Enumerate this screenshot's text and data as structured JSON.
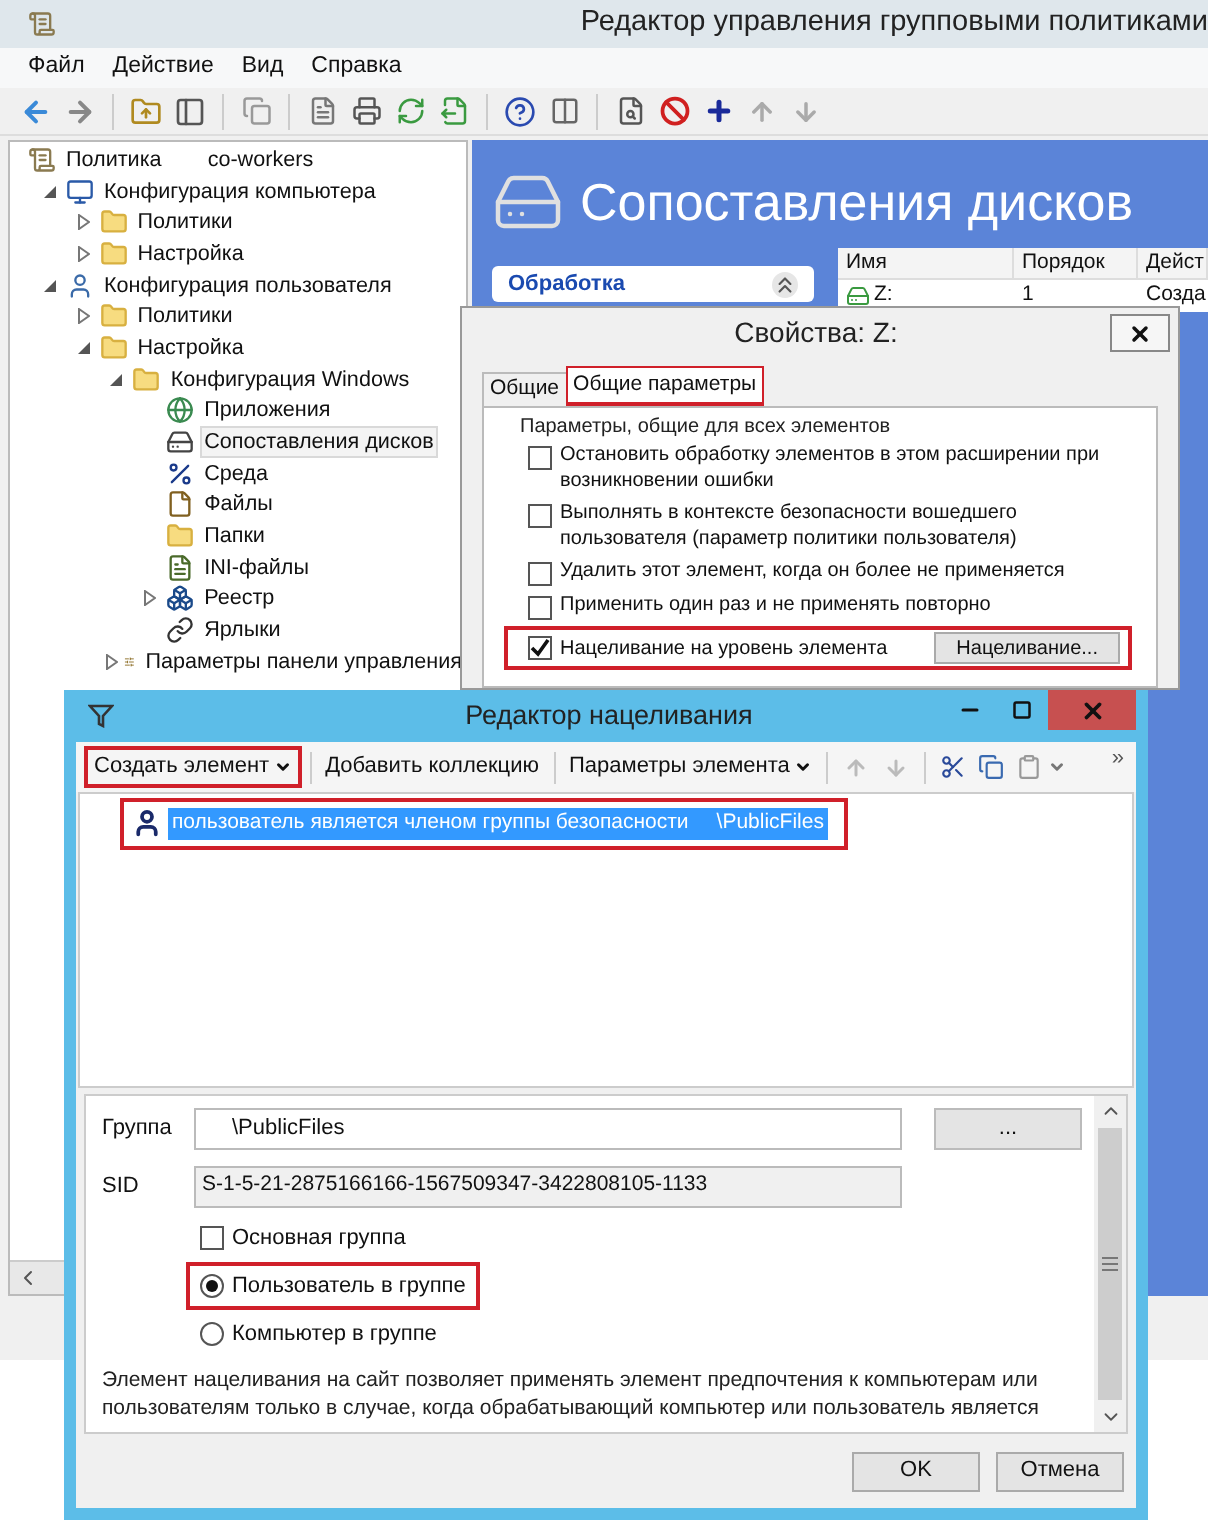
{
  "main_window": {
    "title": "Редактор управления групповыми политиками",
    "menu": [
      "Файл",
      "Действие",
      "Вид",
      "Справка"
    ],
    "tree": [
      {
        "kind": "policy",
        "label": "Политика",
        "suffix": "co-workers",
        "selected": false,
        "children": [
          {
            "kind": "computer",
            "label": "Конфигурация компьютера",
            "expanded": true,
            "selected": false,
            "children": [
              {
                "kind": "folder",
                "label": "Политики",
                "expanded": false,
                "selected": false
              },
              {
                "kind": "folder",
                "label": "Настройка",
                "expanded": false,
                "selected": false
              }
            ]
          },
          {
            "kind": "user",
            "label": "Конфигурация пользователя",
            "expanded": true,
            "selected": false,
            "children": [
              {
                "kind": "folder",
                "label": "Политики",
                "expanded": false,
                "selected": false
              },
              {
                "kind": "folder",
                "label": "Настройка",
                "expanded": true,
                "selected": false,
                "children": [
                  {
                    "kind": "folder",
                    "label": "Конфигурация Windows",
                    "expanded": true,
                    "selected": false,
                    "children": [
                      {
                        "kind": "apps",
                        "label": "Приложения",
                        "selected": false
                      },
                      {
                        "kind": "drive",
                        "label": "Сопоставления дисков",
                        "selected": true
                      },
                      {
                        "kind": "environment",
                        "label": "Среда",
                        "selected": false
                      },
                      {
                        "kind": "files",
                        "label": "Файлы",
                        "selected": false
                      },
                      {
                        "kind": "folders",
                        "label": "Папки",
                        "selected": false
                      },
                      {
                        "kind": "ini",
                        "label": "INI-файлы",
                        "selected": false
                      },
                      {
                        "kind": "registry",
                        "label": "Реестр",
                        "expanded": false,
                        "selected": false
                      },
                      {
                        "kind": "shortcut",
                        "label": "Ярлыки",
                        "selected": false
                      }
                    ]
                  },
                  {
                    "kind": "control-panel",
                    "label": "Параметры панели управления",
                    "expanded": false,
                    "selected": false
                  }
                ]
              }
            ]
          }
        ]
      }
    ],
    "banner": {
      "title": "Сопоставления дисков"
    },
    "side_panel": {
      "title": "Обработка"
    },
    "list": {
      "columns": [
        "Имя",
        "Порядок",
        "Дейст"
      ],
      "rows": [
        [
          "Z:",
          "1",
          "Созда"
        ]
      ]
    }
  },
  "properties_dialog": {
    "title": "Свойства: Z:",
    "tabs": [
      {
        "label": "Общие",
        "selected": false,
        "highlighted": false
      },
      {
        "label": "Общие параметры",
        "selected": true,
        "highlighted": true
      }
    ],
    "group_title": "Параметры, общие для всех элементов",
    "options": [
      {
        "label": "Остановить обработку элементов в этом расширении при возникновении ошибки",
        "checked": false,
        "highlighted": false
      },
      {
        "label": "Выполнять в контексте безопасности вошедшего пользователя (параметр политики пользователя)",
        "checked": false,
        "highlighted": false
      },
      {
        "label": "Удалить этот элемент, когда он более не применяется",
        "checked": false,
        "highlighted": false
      },
      {
        "label": "Применить один раз и не применять повторно",
        "checked": false,
        "highlighted": false
      },
      {
        "label": "Нацеливание на уровень элемента",
        "checked": true,
        "highlighted": true,
        "button": "Нацеливание..."
      }
    ]
  },
  "targeting_editor": {
    "title": "Редактор нацеливания",
    "toolbar": [
      {
        "kind": "dropdown",
        "label": "Создать элемент",
        "highlighted": true
      },
      {
        "kind": "button",
        "label": "Добавить коллекцию",
        "highlighted": false
      },
      {
        "kind": "dropdown",
        "label": "Параметры элемента",
        "highlighted": false
      }
    ],
    "overflow": "»",
    "items": [
      {
        "label": "пользователь является членом группы безопасности",
        "value": "\\PublicFiles",
        "selected": true,
        "highlighted": true
      }
    ],
    "group_label": "Группа",
    "group_value": "\\PublicFiles",
    "browse_button": "...",
    "sid_label": "SID",
    "sid_value": "S-1-5-21-2875166166-1567509347-3422808105-1133",
    "options": [
      {
        "kind": "checkbox",
        "label": "Основная группа",
        "checked": false,
        "highlighted": false
      },
      {
        "kind": "radio",
        "label": "Пользователь в группе",
        "selected": true,
        "highlighted": true
      },
      {
        "kind": "radio",
        "label": "Компьютер в группе",
        "selected": false,
        "highlighted": false
      }
    ],
    "description": "Элемент нацеливания на сайт позволяет применять элемент предпочтения к компьютерам или пользователям только в случае, когда обрабатывающий компьютер или пользователь является",
    "buttons": [
      "OK",
      "Отмена"
    ]
  }
}
